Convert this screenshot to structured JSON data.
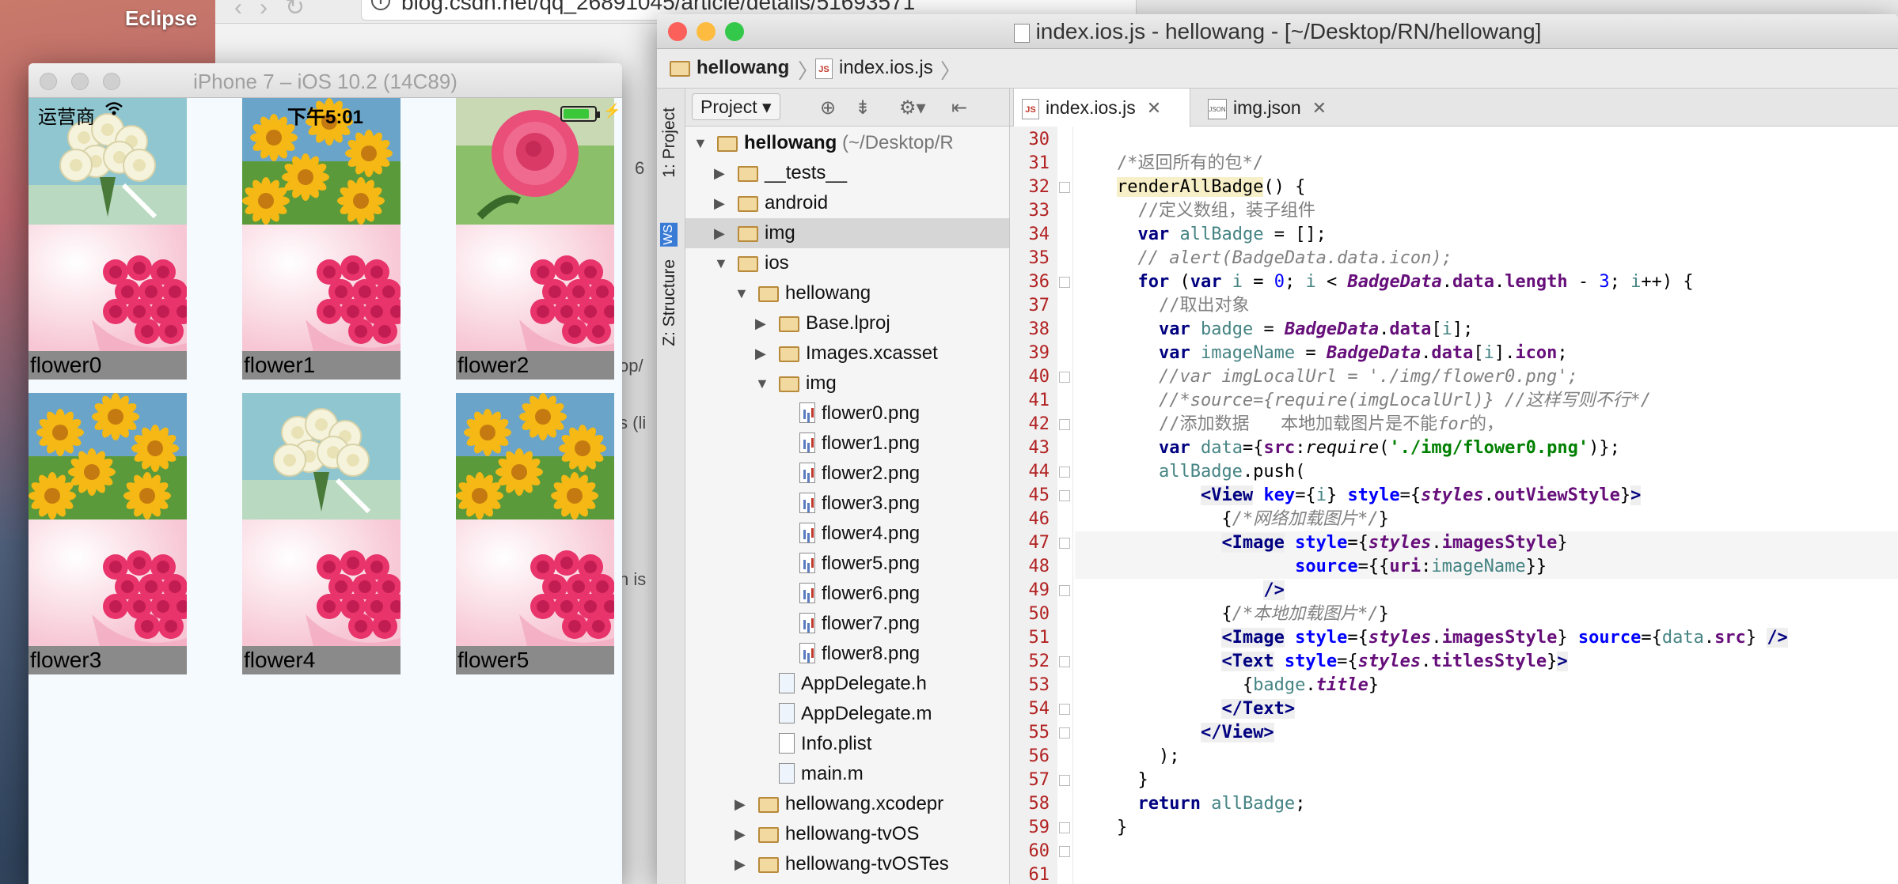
{
  "desktop": {
    "label": "Eclipse"
  },
  "browser": {
    "url": "blog.csdn.net/qq_26891045/article/details/51693571",
    "fragments": [
      "6",
      "op/",
      "s (li",
      "n is"
    ]
  },
  "simulator": {
    "title": "iPhone 7 – iOS 10.2 (14C89)",
    "carrier": "运营商",
    "time": "下午5:01",
    "battery_level": 0.85,
    "cells": [
      {
        "title": "flower0",
        "top_image": "white-roses"
      },
      {
        "title": "flower1",
        "top_image": "yellow-daisies"
      },
      {
        "title": "flower2",
        "top_image": "red-rose"
      },
      {
        "title": "flower3",
        "top_image": "yellow-daisies"
      },
      {
        "title": "flower4",
        "top_image": "white-roses"
      },
      {
        "title": "flower5",
        "top_image": "yellow-daisies"
      }
    ],
    "bottom_image": "pink-roses-bouquet"
  },
  "ide": {
    "title": "index.ios.js - hellowang - [~/Desktop/RN/hellowang]",
    "breadcrumb": [
      "hellowang",
      "index.ios.js"
    ],
    "side_tabs": [
      "1: Project",
      "Z: Structure"
    ],
    "project_dropdown": "Project",
    "tree": [
      {
        "label": "hellowang",
        "suffix": " (~/Desktop/R",
        "type": "folder",
        "arrow": "down",
        "bold": true
      },
      {
        "label": "__tests__",
        "type": "folder",
        "arrow": "right"
      },
      {
        "label": "android",
        "type": "folder",
        "arrow": "right"
      },
      {
        "label": "img",
        "type": "folder",
        "arrow": "right",
        "selected": true
      },
      {
        "label": "ios",
        "type": "folder",
        "arrow": "down"
      },
      {
        "label": "hellowang",
        "type": "folder",
        "arrow": "down"
      },
      {
        "label": "Base.lproj",
        "type": "folder",
        "arrow": "right"
      },
      {
        "label": "Images.xcasset",
        "type": "folder",
        "arrow": "right"
      },
      {
        "label": "img",
        "type": "folder",
        "arrow": "down"
      },
      {
        "label": "flower0.png",
        "type": "png"
      },
      {
        "label": "flower1.png",
        "type": "png"
      },
      {
        "label": "flower2.png",
        "type": "png"
      },
      {
        "label": "flower3.png",
        "type": "png"
      },
      {
        "label": "flower4.png",
        "type": "png"
      },
      {
        "label": "flower5.png",
        "type": "png"
      },
      {
        "label": "flower6.png",
        "type": "png"
      },
      {
        "label": "flower7.png",
        "type": "png"
      },
      {
        "label": "flower8.png",
        "type": "png"
      },
      {
        "label": "AppDelegate.h",
        "type": "h"
      },
      {
        "label": "AppDelegate.m",
        "type": "m"
      },
      {
        "label": "Info.plist",
        "type": "plist"
      },
      {
        "label": "main.m",
        "type": "m"
      },
      {
        "label": "hellowang.xcodepr",
        "type": "folder",
        "arrow": "right"
      },
      {
        "label": "hellowang-tvOS",
        "type": "folder",
        "arrow": "right"
      },
      {
        "label": "hellowang-tvOSTes",
        "type": "folder",
        "arrow": "right"
      }
    ],
    "tabs": [
      {
        "label": "index.ios.js",
        "icon": "js",
        "active": true
      },
      {
        "label": "img.json",
        "icon": "json",
        "active": false
      }
    ],
    "line_numbers": [
      "30",
      "31",
      "32",
      "33",
      "34",
      "35",
      "36",
      "37",
      "38",
      "39",
      "40",
      "41",
      "42",
      "43",
      "44",
      "45",
      "46",
      "47",
      "48",
      "49",
      "50",
      "51",
      "52",
      "53",
      "54",
      "55",
      "56",
      "57",
      "58",
      "59",
      "60",
      "61"
    ],
    "code": [
      [],
      [
        [
          "cm-n",
          "    /*返回所有的包*/"
        ]
      ],
      [
        [
          "",
          "    "
        ],
        [
          "fn",
          "renderAllBadge"
        ],
        [
          "",
          "() {"
        ]
      ],
      [
        [
          "cmn",
          "      //定义数组，装子组件"
        ]
      ],
      [
        [
          "",
          "      "
        ],
        [
          "kw",
          "var"
        ],
        [
          "",
          " "
        ],
        [
          "id",
          "allBadge"
        ],
        [
          "",
          " = [];"
        ]
      ],
      [
        [
          "cm",
          "      // alert(BadgeData.data.icon);"
        ]
      ],
      [
        [
          "",
          "      "
        ],
        [
          "kw",
          "for"
        ],
        [
          "",
          " ("
        ],
        [
          "kw",
          "var"
        ],
        [
          "",
          " "
        ],
        [
          "id",
          "i"
        ],
        [
          "",
          " = "
        ],
        [
          "num",
          "0"
        ],
        [
          "",
          "; "
        ],
        [
          "id",
          "i"
        ],
        [
          "",
          " < "
        ],
        [
          "cls",
          "BadgeData"
        ],
        [
          "",
          "."
        ],
        [
          "prop",
          "data"
        ],
        [
          "",
          "."
        ],
        [
          "prop",
          "length"
        ],
        [
          "",
          " - "
        ],
        [
          "num",
          "3"
        ],
        [
          "",
          "; "
        ],
        [
          "id",
          "i"
        ],
        [
          "",
          "++) {"
        ]
      ],
      [
        [
          "cmn",
          "        //取出对象"
        ]
      ],
      [
        [
          "",
          "        "
        ],
        [
          "kw",
          "var"
        ],
        [
          "",
          " "
        ],
        [
          "id",
          "badge"
        ],
        [
          "",
          " = "
        ],
        [
          "cls",
          "BadgeData"
        ],
        [
          "",
          "."
        ],
        [
          "prop",
          "data"
        ],
        [
          "",
          "["
        ],
        [
          "id",
          "i"
        ],
        [
          "",
          "];"
        ]
      ],
      [
        [
          "",
          "        "
        ],
        [
          "kw",
          "var"
        ],
        [
          "",
          " "
        ],
        [
          "id",
          "imageName"
        ],
        [
          "",
          " = "
        ],
        [
          "cls",
          "BadgeData"
        ],
        [
          "",
          "."
        ],
        [
          "prop",
          "data"
        ],
        [
          "",
          "["
        ],
        [
          "id",
          "i"
        ],
        [
          "",
          "]."
        ],
        [
          "prop",
          "icon"
        ],
        [
          "",
          ";"
        ]
      ],
      [
        [
          "cm",
          "        //var imgLocalUrl = './img/flower0.png';"
        ]
      ],
      [
        [
          "cm",
          "        //*source={require(imgLocalUrl)} //这样写则不行*/"
        ]
      ],
      [
        [
          "cmn",
          "        //添加数据   本地加载图片是不能"
        ],
        [
          "cm",
          "for"
        ],
        [
          "cmn",
          "的，"
        ]
      ],
      [
        [
          "",
          "        "
        ],
        [
          "kw",
          "var"
        ],
        [
          "",
          " "
        ],
        [
          "id",
          "data"
        ],
        [
          "",
          "={"
        ],
        [
          "prop",
          "src"
        ],
        [
          "",
          ":"
        ],
        [
          "it",
          "require"
        ],
        [
          "",
          "("
        ],
        [
          "str",
          "'./img/flower0.png'"
        ],
        [
          "",
          ")};"
        ]
      ],
      [
        [
          "",
          "        "
        ],
        [
          "id",
          "allBadge"
        ],
        [
          "",
          ".push("
        ]
      ],
      [
        [
          "",
          "            "
        ],
        [
          "tag",
          "<View"
        ],
        [
          "",
          " "
        ],
        [
          "attr",
          "key"
        ],
        [
          "",
          "={"
        ],
        [
          "id",
          "i"
        ],
        [
          "",
          "} "
        ],
        [
          "attr",
          "style"
        ],
        [
          "",
          "={"
        ],
        [
          "cls",
          "styles"
        ],
        [
          "",
          "."
        ],
        [
          "prop",
          "outViewStyle"
        ],
        [
          "",
          "}"
        ],
        [
          "tag",
          ">"
        ]
      ],
      [
        [
          "",
          "              {"
        ],
        [
          "cm",
          "/*网络加载图片*/"
        ],
        [
          "",
          "}"
        ]
      ],
      [
        [
          "",
          "              "
        ],
        [
          "tag",
          "<Image"
        ],
        [
          "",
          " "
        ],
        [
          "attr",
          "style"
        ],
        [
          "",
          "={"
        ],
        [
          "cls",
          "styles"
        ],
        [
          "",
          "."
        ],
        [
          "prop",
          "imagesStyle"
        ],
        [
          "",
          "}"
        ]
      ],
      [
        [
          "",
          "                     "
        ],
        [
          "attr",
          "source"
        ],
        [
          "",
          "={{"
        ],
        [
          "prop",
          "uri"
        ],
        [
          "",
          ":"
        ],
        [
          "id",
          "imageName"
        ],
        [
          "",
          "}}"
        ]
      ],
      [
        [
          "",
          "                  "
        ],
        [
          "tag",
          "/>"
        ]
      ],
      [
        [
          "",
          "              {"
        ],
        [
          "cm",
          "/*本地加载图片*/"
        ],
        [
          "",
          "}"
        ]
      ],
      [
        [
          "",
          "              "
        ],
        [
          "tag",
          "<Image"
        ],
        [
          "",
          " "
        ],
        [
          "attr",
          "style"
        ],
        [
          "",
          "={"
        ],
        [
          "cls",
          "styles"
        ],
        [
          "",
          "."
        ],
        [
          "prop",
          "imagesStyle"
        ],
        [
          "",
          "} "
        ],
        [
          "attr",
          "source"
        ],
        [
          "",
          "={"
        ],
        [
          "id",
          "data"
        ],
        [
          "",
          "."
        ],
        [
          "prop",
          "src"
        ],
        [
          "",
          "} "
        ],
        [
          "tag",
          "/>"
        ]
      ],
      [
        [
          "",
          "              "
        ],
        [
          "tag",
          "<Text"
        ],
        [
          "",
          " "
        ],
        [
          "attr",
          "style"
        ],
        [
          "",
          "={"
        ],
        [
          "cls",
          "styles"
        ],
        [
          "",
          "."
        ],
        [
          "prop",
          "titlesStyle"
        ],
        [
          "",
          "}"
        ],
        [
          "tag",
          ">"
        ]
      ],
      [
        [
          "",
          "                {"
        ],
        [
          "id",
          "badge"
        ],
        [
          "",
          "."
        ],
        [
          "prop2",
          "title"
        ],
        [
          "",
          "}"
        ]
      ],
      [
        [
          "",
          "              "
        ],
        [
          "tag",
          "</Text>"
        ]
      ],
      [
        [
          "",
          "            "
        ],
        [
          "tag",
          "</View>"
        ]
      ],
      [
        [
          "",
          "        );"
        ]
      ],
      [
        [
          "",
          "      }"
        ]
      ],
      [
        [
          "",
          "      "
        ],
        [
          "kw",
          "return"
        ],
        [
          "",
          " "
        ],
        [
          "id",
          "allBadge"
        ],
        [
          "",
          ";"
        ]
      ],
      [
        [
          "",
          "    }"
        ]
      ],
      [],
      []
    ],
    "highlighted_lines": [
      47,
      48
    ]
  },
  "colors": {
    "traffic_red": "#fc605b",
    "traffic_yellow": "#fdbc40",
    "traffic_green": "#34c84a"
  }
}
